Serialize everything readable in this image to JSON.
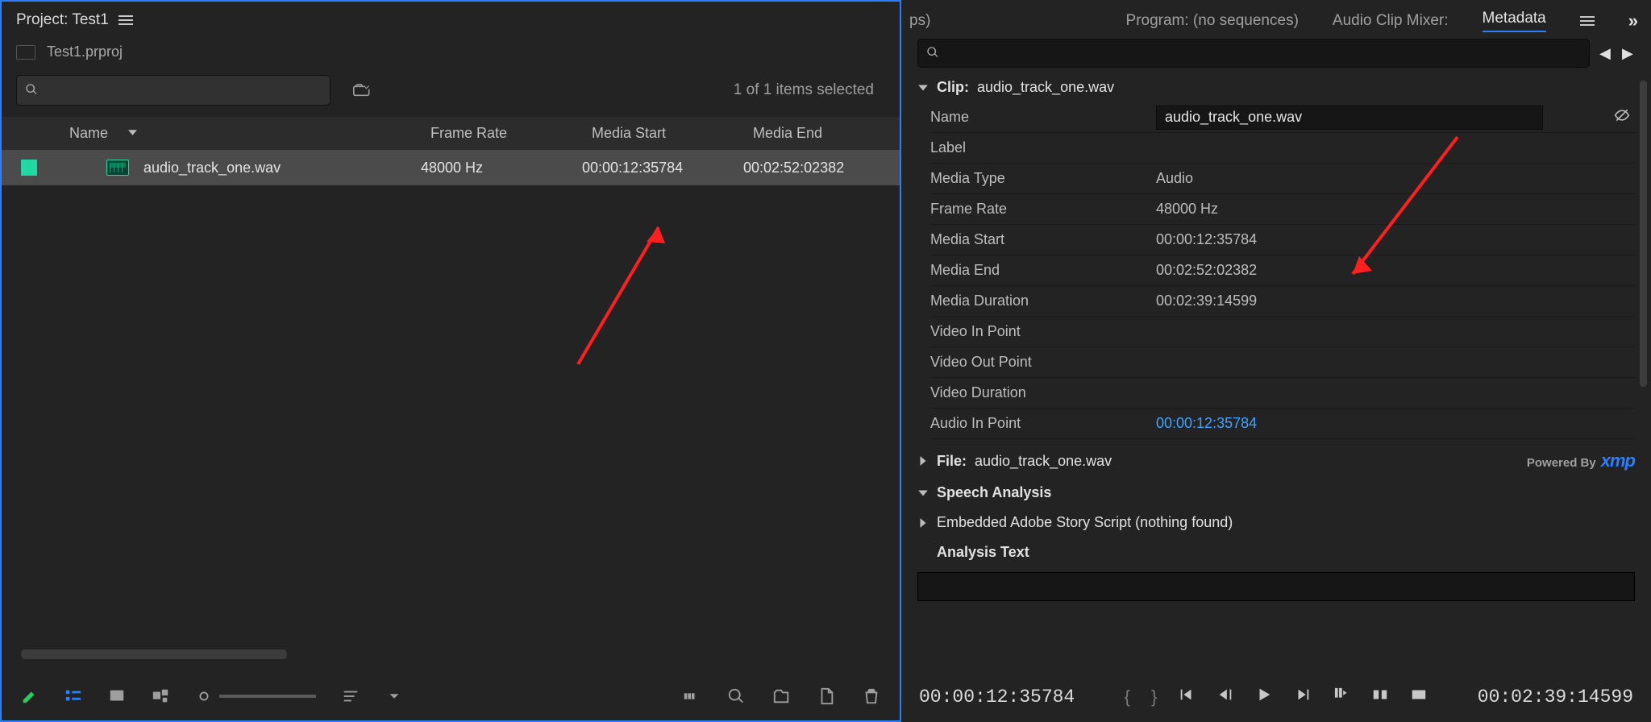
{
  "left": {
    "project_label": "Project: Test1",
    "file_name": "Test1.prproj",
    "selection_text": "1 of 1 items selected",
    "columns": {
      "name": "Name",
      "frame_rate": "Frame Rate",
      "media_start": "Media Start",
      "media_end": "Media End"
    },
    "rows": [
      {
        "name": "audio_track_one.wav",
        "frame_rate": "48000 Hz",
        "media_start": "00:00:12:35784",
        "media_end": "00:02:52:02382"
      }
    ]
  },
  "right": {
    "tabs": {
      "ps": "ps)",
      "program": "Program: (no sequences)",
      "mixer": "Audio Clip Mixer:",
      "metadata": "Metadata"
    },
    "clip_section": {
      "label": "Clip:",
      "filename": "audio_track_one.wav"
    },
    "fields": {
      "name_key": "Name",
      "name_val": "audio_track_one.wav",
      "label_key": "Label",
      "media_type_key": "Media Type",
      "media_type_val": "Audio",
      "frame_rate_key": "Frame Rate",
      "frame_rate_val": "48000 Hz",
      "media_start_key": "Media Start",
      "media_start_val": "00:00:12:35784",
      "media_end_key": "Media End",
      "media_end_val": "00:02:52:02382",
      "media_dur_key": "Media Duration",
      "media_dur_val": "00:02:39:14599",
      "vin_key": "Video In Point",
      "vout_key": "Video Out Point",
      "vdur_key": "Video Duration",
      "ain_key": "Audio In Point",
      "ain_val": "00:00:12:35784"
    },
    "file_section": {
      "label": "File:",
      "filename": "audio_track_one.wav",
      "powered": "Powered By",
      "xmp": "xmp"
    },
    "speech_label": "Speech Analysis",
    "story_label": "Embedded Adobe Story Script (nothing found)",
    "analysis_label": "Analysis Text",
    "timeline": {
      "in_tc": "00:00:12:35784",
      "out_tc": "00:02:39:14599"
    }
  }
}
